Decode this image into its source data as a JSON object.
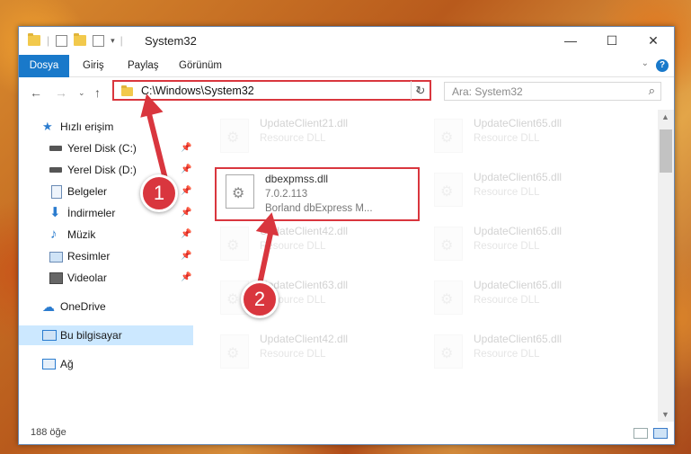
{
  "window": {
    "title": "System32"
  },
  "ribbon": {
    "tabs": [
      "Dosya",
      "Giriş",
      "Paylaş",
      "Görünüm"
    ]
  },
  "address": {
    "path": "C:\\Windows\\System32"
  },
  "search": {
    "placeholder": "Ara: System32"
  },
  "nav": {
    "quick_access": "Hızlı erişim",
    "items": [
      {
        "label": "Yerel Disk (C:)",
        "icon": "drive-icon"
      },
      {
        "label": "Yerel Disk (D:)",
        "icon": "drive-icon"
      },
      {
        "label": "Belgeler",
        "icon": "documents-icon"
      },
      {
        "label": "İndirmeler",
        "icon": "download-icon"
      },
      {
        "label": "Müzik",
        "icon": "music-icon"
      },
      {
        "label": "Resimler",
        "icon": "pictures-icon"
      },
      {
        "label": "Videolar",
        "icon": "videos-icon"
      }
    ],
    "onedrive": "OneDrive",
    "this_pc": "Bu bilgisayar",
    "network": "Ağ"
  },
  "files": {
    "highlighted": {
      "name": "dbexpmss.dll",
      "version": "7.0.2.113",
      "company": "Borland dbExpress M..."
    },
    "left": [
      {
        "name": "UpdateClient21.dll",
        "desc": "Resource DLL"
      },
      {
        "name": "UpdateClient42.dll",
        "desc": "Resource DLL"
      },
      {
        "name": "UpdateClient63.dll",
        "desc": "Resource DLL"
      },
      {
        "name": "UpdateClient42.dll",
        "desc": "Resource DLL"
      }
    ],
    "right": [
      {
        "name": "UpdateClient65.dll",
        "desc": "Resource DLL"
      },
      {
        "name": "UpdateClient65.dll",
        "desc": "Resource DLL"
      },
      {
        "name": "UpdateClient65.dll",
        "desc": "Resource DLL"
      },
      {
        "name": "UpdateClient65.dll",
        "desc": "Resource DLL"
      },
      {
        "name": "UpdateClient65.dll",
        "desc": "Resource DLL"
      }
    ]
  },
  "status": {
    "count": "188 öğe"
  },
  "callouts": {
    "one": "1",
    "two": "2"
  },
  "colors": {
    "accent": "#1979ca",
    "highlight": "#d9363e",
    "selection": "#cce8ff"
  }
}
